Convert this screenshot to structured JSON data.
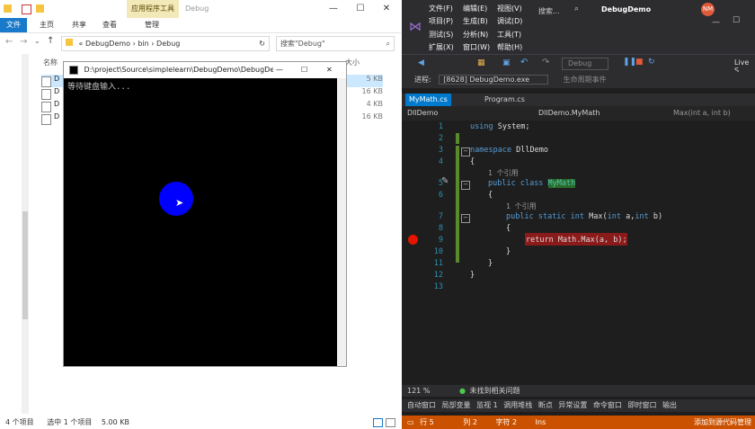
{
  "explorer": {
    "ribbon_context": "应用程序工具",
    "window_title": "Debug",
    "tabs": [
      "文件",
      "主页",
      "共享",
      "查看",
      "管理"
    ],
    "breadcrumb": [
      "«",
      "DebugDemo",
      "›",
      "bin",
      "›",
      "Debug"
    ],
    "search_placeholder": "搜索\"Debug\"",
    "column_name": "名称",
    "column_size": "大小",
    "files": [
      {
        "name": "D",
        "size": "5 KB"
      },
      {
        "name": "D",
        "size": "16 KB"
      },
      {
        "name": "D",
        "size": "4 KB"
      },
      {
        "name": "D",
        "size": "16 KB"
      }
    ],
    "status_items": "4 个项目",
    "status_selected": "选中 1 个项目",
    "status_size": "5.00 KB"
  },
  "console": {
    "title": "D:\\project\\Source\\simplelearn\\DebugDemo\\DebugDemo\\bin\\Debu...",
    "text": "等待键盘输入..."
  },
  "vs": {
    "menu": [
      [
        "文件(F)",
        "编辑(E)",
        "视图(V)"
      ],
      [
        "项目(P)",
        "生成(B)",
        "调试(D)"
      ],
      [
        "测试(S)",
        "分析(N)",
        "工具(T)"
      ],
      [
        "扩展(X)",
        "窗口(W)",
        "帮助(H)"
      ]
    ],
    "search_label": "搜索...",
    "solution_name": "DebugDemo",
    "user_initials": "NM",
    "toolbar_debug": "Debug",
    "live_share": "Live S",
    "process_label": "进程:",
    "process_value": "[8628] DebugDemo.exe",
    "lifecycle_label": "生命周期事件",
    "doc_tabs": [
      "MyMath.cs",
      "Program.cs"
    ],
    "nav": [
      "DllDemo",
      "DllDemo.MyMath",
      "Max(int a, int b)"
    ],
    "lines": [
      "1",
      "2",
      "3",
      "4",
      "5",
      "6",
      "7",
      "8",
      "9",
      "10",
      "11",
      "12",
      "13"
    ],
    "code": {
      "using_kw": "using",
      "using_ns": " System;",
      "namespace_kw": "namespace",
      "namespace_name": " DllDemo",
      "brace_open": "{",
      "brace_close": "}",
      "ref_class": "1 个引用",
      "public_kw": "public",
      "class_kw": " class ",
      "class_name": "MyMath",
      "ref_method": "1 个引用",
      "static_kw": " static ",
      "int_kw": "int",
      "method_sig_a": " Max(",
      "param_a": " a,",
      "param_b": " b)",
      "return_line": "return Math.Max(a, b);"
    },
    "zoom": "121 %",
    "no_issues": "未找到相关问题",
    "bottom_tabs": [
      "自动窗口",
      "局部变量",
      "监视 1",
      "调用堆栈",
      "断点",
      "异常设置",
      "命令窗口",
      "即时窗口",
      "输出"
    ],
    "status_line": "行 5",
    "status_col": "列 2",
    "status_char": "字符 2",
    "status_ins": "Ins",
    "status_source": "添加到源代码管理"
  },
  "colors": {
    "vs_status_bg": "#ca5100",
    "vs_accent": "#007acc",
    "breakpoint": "#e51400",
    "ball": "#0000ff"
  }
}
